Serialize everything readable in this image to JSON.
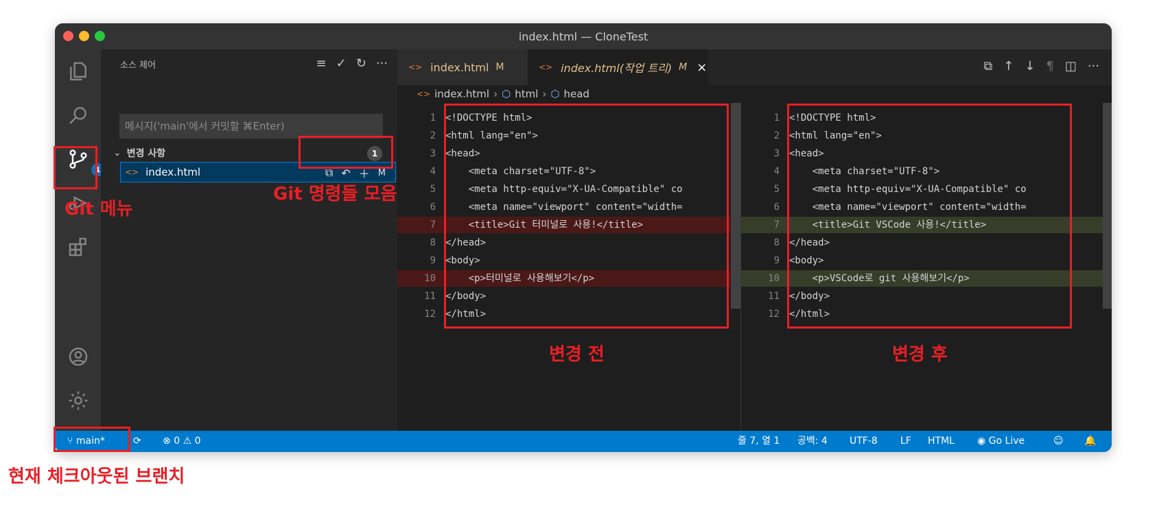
{
  "window": {
    "title": "index.html — CloneTest",
    "traffic_lights": [
      "#ff5f57",
      "#febc2e",
      "#28c840"
    ]
  },
  "activity_bar": {
    "items": [
      {
        "name": "explorer"
      },
      {
        "name": "search"
      },
      {
        "name": "source-control",
        "badge": "1"
      },
      {
        "name": "run-debug"
      },
      {
        "name": "extensions"
      },
      {
        "name": "accounts"
      },
      {
        "name": "manage"
      }
    ]
  },
  "sidebar": {
    "title": "소스 제어",
    "tools": [
      "≡",
      "✓",
      "↻",
      "···"
    ],
    "commit_placeholder": "메시지('main'에서 커밋할 ⌘Enter)",
    "changes_label": "변경 사항",
    "changes_count": "1",
    "file": {
      "name": "index.html",
      "status": "M"
    }
  },
  "tabs": [
    {
      "label": "index.html",
      "status": "M"
    },
    {
      "label": "index.html(작업 트리)",
      "status": "M",
      "close": "×"
    }
  ],
  "editor_tools": [
    "⧉",
    "↑",
    "↓",
    "¶",
    "◫",
    "···"
  ],
  "breadcrumb": [
    "index.html",
    "html",
    "head"
  ],
  "diff": {
    "lines": [
      {
        "no": "1",
        "left": "<!DOCTYPE html>",
        "right": "<!DOCTYPE html>"
      },
      {
        "no": "2",
        "left": "<html lang=\"en\">",
        "right": "<html lang=\"en\">"
      },
      {
        "no": "3",
        "left": "<head>",
        "right": "<head>"
      },
      {
        "no": "4",
        "left": "    <meta charset=\"UTF-8\">",
        "right": "    <meta charset=\"UTF-8\">"
      },
      {
        "no": "5",
        "left": "    <meta http-equiv=\"X-UA-Compatible\" co",
        "right": "    <meta http-equiv=\"X-UA-Compatible\" co"
      },
      {
        "no": "6",
        "left": "    <meta name=\"viewport\" content=\"width=",
        "right": "    <meta name=\"viewport\" content=\"width="
      },
      {
        "no": "7",
        "left": "    <title>Git 터미널로 사용!</title>",
        "right": "    <title>Git VSCode 사용!</title>"
      },
      {
        "no": "8",
        "left": "</head>",
        "right": "</head>"
      },
      {
        "no": "9",
        "left": "<body>",
        "right": "<body>"
      },
      {
        "no": "10",
        "left": "    <p>터미널로 사용해보기</p>",
        "right": "    <p>VSCode로 git 사용해보기</p>"
      },
      {
        "no": "11",
        "left": "</body>",
        "right": "</body>"
      },
      {
        "no": "12",
        "left": "</html>",
        "right": "</html>"
      }
    ]
  },
  "status_bar": {
    "branch": "main*",
    "errors": "0",
    "warnings": "0",
    "cursor": "줄 7, 열 1",
    "spaces": "공백: 4",
    "encoding": "UTF-8",
    "eol": "LF",
    "language": "HTML",
    "go_live": "Go Live"
  },
  "annotations": {
    "git_menu": "Git 메뉴",
    "git_commands": "Git 명령들 모음",
    "before": "변경 전",
    "after": "변경 후",
    "branch": "현재 체크아웃된 브랜치"
  },
  "colors": {
    "annotation": "#e81f26",
    "status_bar": "#007acc",
    "deleted_line": "#4b1818",
    "inserted_line": "#373d29"
  }
}
